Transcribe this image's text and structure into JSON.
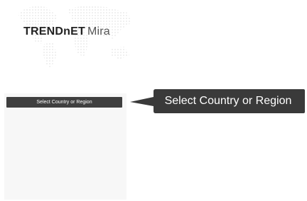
{
  "brand": {
    "name": "TRENDnET",
    "product": "Mira"
  },
  "country_select": {
    "label": "Select Country or Region"
  },
  "callout": {
    "text": "Select Country or Region"
  },
  "colors": {
    "select_bar": "#3f3f3f",
    "callout": "#3a3a3a",
    "panel": "#f7f7f7",
    "map_dots": "#ececec"
  },
  "icons": {
    "background": "world-map-dots"
  }
}
